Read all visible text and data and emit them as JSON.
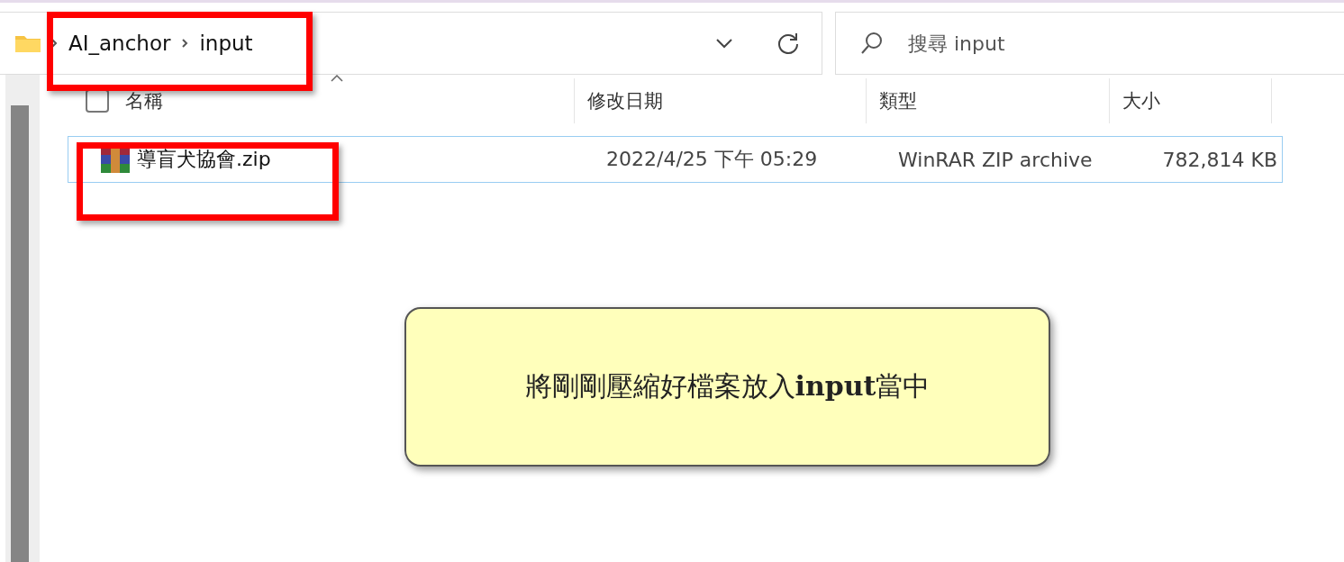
{
  "address_bar": {
    "breadcrumb": [
      "AI_anchor",
      "input"
    ],
    "highlighted": true
  },
  "search": {
    "placeholder": "搜尋 input"
  },
  "header_checkbox": {
    "checked": false
  },
  "columns": [
    {
      "label": "名稱",
      "sorted": true
    },
    {
      "label": "修改日期"
    },
    {
      "label": "類型"
    },
    {
      "label": "大小"
    }
  ],
  "rows": [
    {
      "name": "導盲犬協會.zip",
      "modified": "2022/4/25 下午 05:29",
      "type": "WinRAR ZIP archive",
      "size": "782,814 KB",
      "selected": true,
      "highlighted": true
    }
  ],
  "callout": {
    "text": "將剛剛壓縮好檔案放入**input**當中"
  }
}
